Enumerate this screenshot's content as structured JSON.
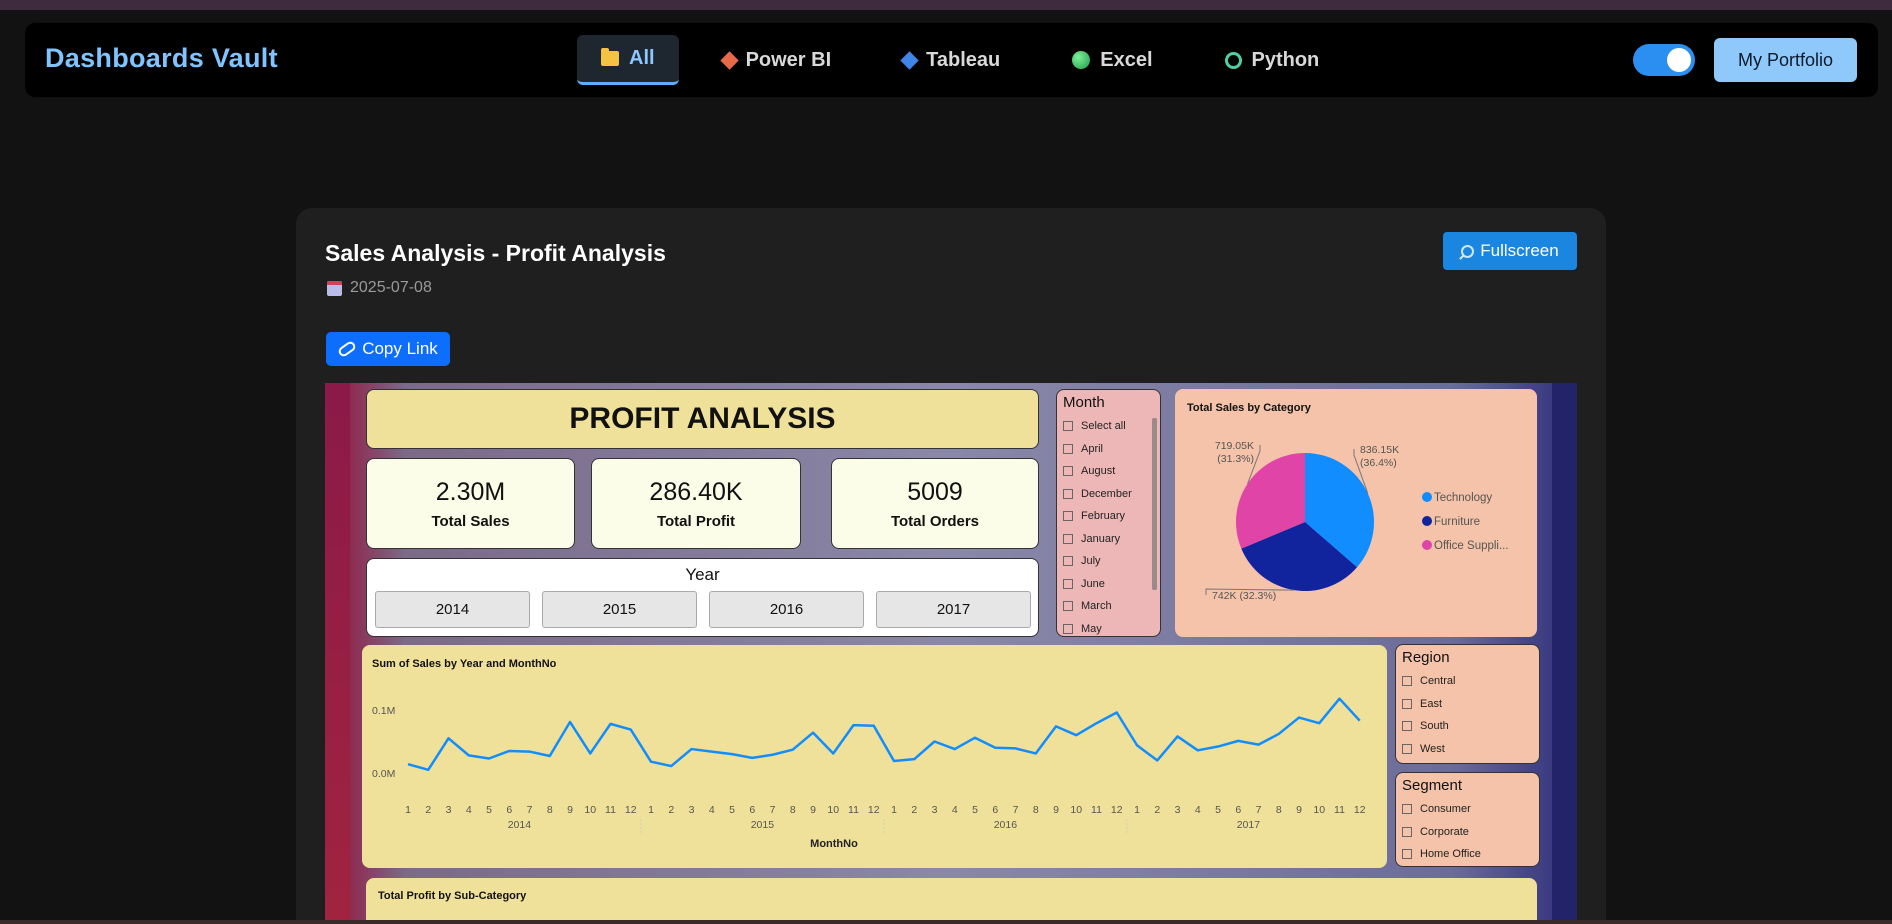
{
  "navbar": {
    "brand": "Dashboards Vault",
    "tabs": [
      {
        "label": "All",
        "icon": "folder-icon",
        "active": true
      },
      {
        "label": "Power BI",
        "icon": "powerbi-icon"
      },
      {
        "label": "Tableau",
        "icon": "tableau-icon"
      },
      {
        "label": "Excel",
        "icon": "excel-icon"
      },
      {
        "label": "Python",
        "icon": "python-icon"
      }
    ],
    "theme_toggle_on": true,
    "portfolio_label": "My Portfolio"
  },
  "card": {
    "title": "Sales Analysis - Profit Analysis",
    "date": "2025-07-08",
    "fullscreen_label": "Fullscreen",
    "copy_link_label": "Copy Link"
  },
  "dashboard": {
    "title": "PROFIT ANALYSIS",
    "kpis": [
      {
        "value": "2.30M",
        "label": "Total Sales"
      },
      {
        "value": "286.40K",
        "label": "Total Profit"
      },
      {
        "value": "5009",
        "label": "Total Orders"
      }
    ],
    "year_slicer": {
      "title": "Year",
      "options": [
        "2014",
        "2015",
        "2016",
        "2017"
      ]
    },
    "month_slicer": {
      "title": "Month",
      "options": [
        "Select all",
        "April",
        "August",
        "December",
        "February",
        "January",
        "July",
        "June",
        "March",
        "May"
      ]
    },
    "region_slicer": {
      "title": "Region",
      "options": [
        "Central",
        "East",
        "South",
        "West"
      ]
    },
    "segment_slicer": {
      "title": "Segment",
      "options": [
        "Consumer",
        "Corporate",
        "Home Office"
      ]
    },
    "subcategory_title": "Total Profit by Sub-Category",
    "colors": {
      "technology": "#118dff",
      "furniture": "#12239e",
      "office": "#e044a7",
      "line": "#118dff"
    }
  },
  "chart_data": [
    {
      "type": "pie",
      "title": "Total Sales by Category",
      "categories": [
        "Technology",
        "Furniture",
        "Office Suppli..."
      ],
      "values": [
        836.15,
        742,
        719.05
      ],
      "labels": [
        "836.15K\n(36.4%)",
        "742K (32.3%)",
        "719.05K\n(31.3%)"
      ],
      "percent": [
        36.4,
        32.3,
        31.3
      ],
      "legend": "right"
    },
    {
      "type": "line",
      "title": "Sum of Sales by Year and MonthNo",
      "xlabel": "MonthNo",
      "ylabel": "",
      "yticks": [
        "0.0M",
        "0.1M"
      ],
      "years": [
        "2014",
        "2015",
        "2016",
        "2017"
      ],
      "months": [
        "1",
        "2",
        "3",
        "4",
        "5",
        "6",
        "7",
        "8",
        "9",
        "10",
        "11",
        "12"
      ],
      "ylim": [
        0,
        0.12
      ],
      "values": [
        0.014,
        0.005,
        0.055,
        0.028,
        0.023,
        0.035,
        0.034,
        0.027,
        0.081,
        0.031,
        0.078,
        0.069,
        0.018,
        0.011,
        0.038,
        0.034,
        0.03,
        0.024,
        0.029,
        0.037,
        0.064,
        0.031,
        0.076,
        0.075,
        0.019,
        0.022,
        0.05,
        0.038,
        0.056,
        0.04,
        0.039,
        0.031,
        0.074,
        0.06,
        0.079,
        0.096,
        0.044,
        0.02,
        0.058,
        0.036,
        0.042,
        0.051,
        0.045,
        0.062,
        0.088,
        0.079,
        0.118,
        0.083
      ]
    }
  ]
}
